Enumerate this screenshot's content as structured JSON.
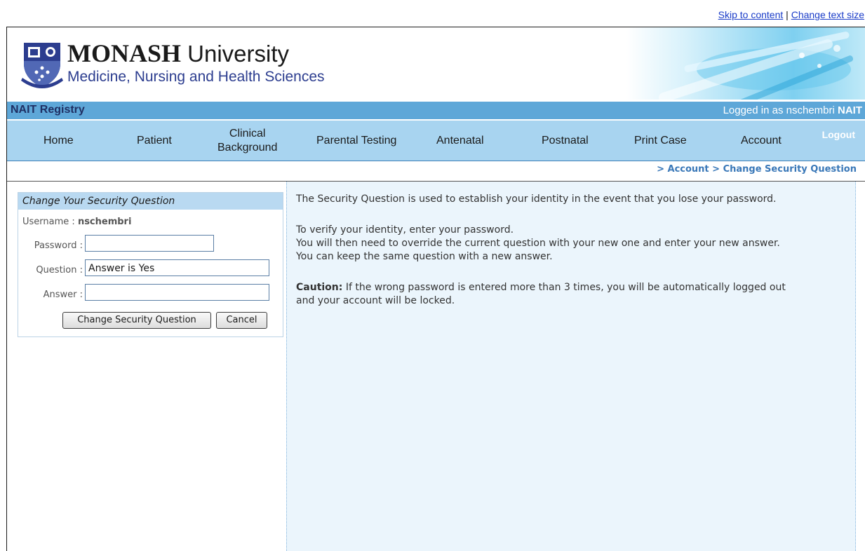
{
  "top_links": {
    "skip": "Skip to content",
    "separator": "|",
    "text_size": "Change text size"
  },
  "brand": {
    "monash": "MONASH",
    "university": " University",
    "faculty": "Medicine, Nursing and Health Sciences"
  },
  "titlebar": {
    "registry": "NAIT Registry",
    "logged_in_prefix": "Logged in as nschembri ",
    "logged_in_org": "NAIT"
  },
  "nav": {
    "home": "Home",
    "patient": "Patient",
    "clinical_line1": "Clinical",
    "clinical_line2": "Background",
    "parental": "Parental Testing",
    "antenatal": "Antenatal",
    "postnatal": "Postnatal",
    "print_case": "Print Case",
    "account": "Account",
    "logout": "Logout"
  },
  "breadcrumb": "> Account > Change Security Question",
  "form": {
    "heading": "Change Your Security Question",
    "username_label": "Username :",
    "username_value": "nschembri",
    "password_label": "Password :",
    "password_value": "",
    "question_label": "Question :",
    "question_value": "Answer is Yes",
    "answer_label": "Answer :",
    "answer_value": "",
    "submit_label": "Change Security Question",
    "cancel_label": "Cancel"
  },
  "info": {
    "p1": "The Security Question is used to establish your identity in the event that you lose your password.",
    "p2a": "To verify your identity, enter your password.",
    "p2b": "You will then need to override the current question with your new one and enter your new answer.",
    "p2c": "You can keep the same question with a new answer.",
    "caution_label": "Caution:",
    "caution_text1": " If the wrong password is entered more than 3 times, you will be automatically logged out",
    "caution_text2": "and your account will be locked."
  },
  "colors": {
    "titlebar": "#5ea7d8",
    "navbar": "#a8d4f0",
    "form_header": "#b9d9f1",
    "info_panel": "#ebf5fc",
    "breadcrumb": "#3a78b8"
  }
}
